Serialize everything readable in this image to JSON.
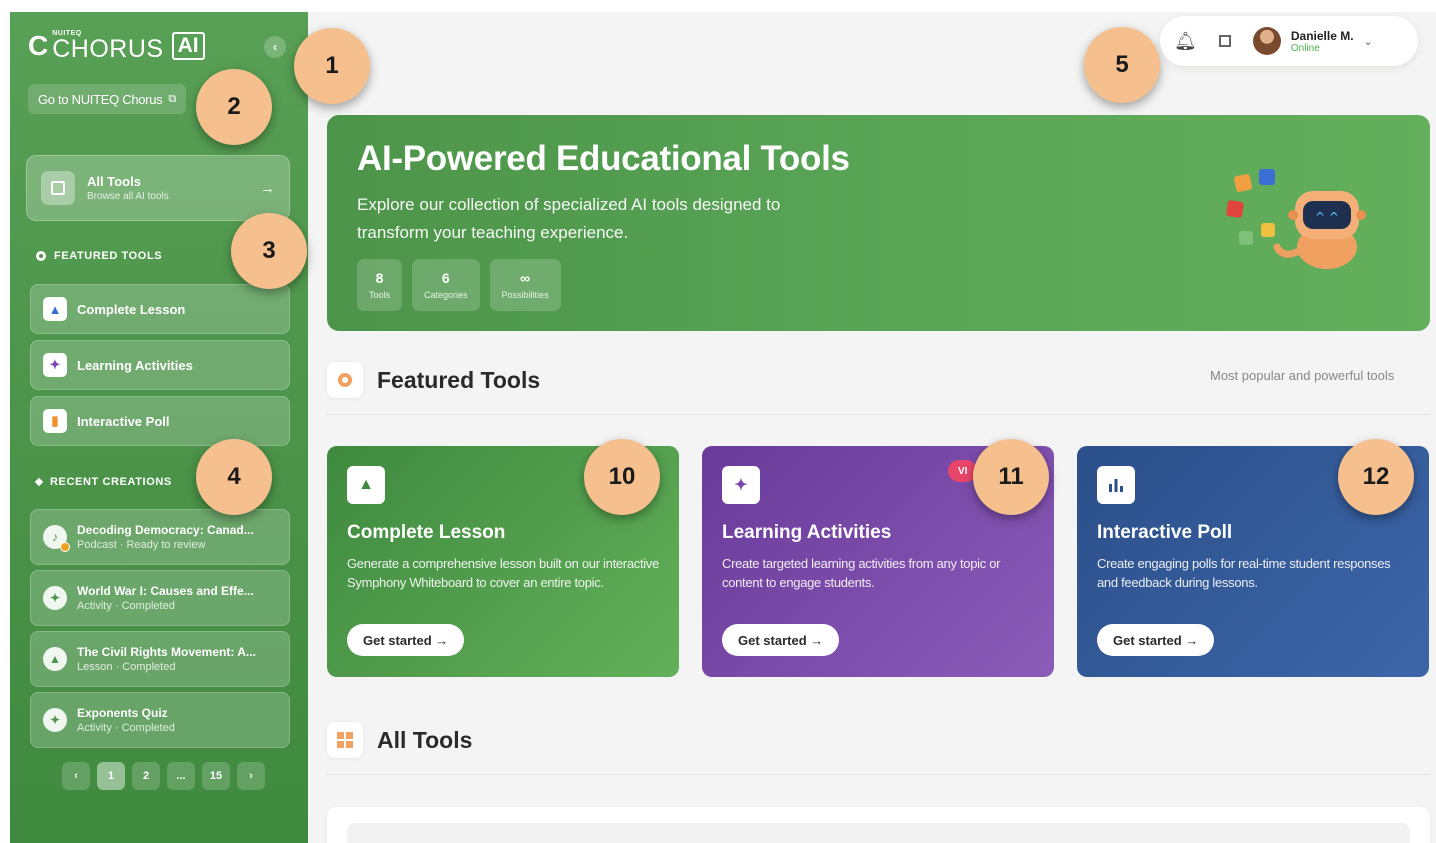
{
  "sidebar": {
    "logo": {
      "c": "C",
      "small": "NUITEQ",
      "big": "CHORUS",
      "ai": "AI"
    },
    "goto_label": "Go to NUITEQ Chorus",
    "all_tools": {
      "title": "All Tools",
      "subtitle": "Browse all AI tools"
    },
    "featured_label": "FEATURED TOOLS",
    "featured": [
      {
        "label": "Complete Lesson",
        "icon": "lesson-icon",
        "color": "#3b6fd6"
      },
      {
        "label": "Learning Activities",
        "icon": "puzzle-icon",
        "color": "#7b45b0"
      },
      {
        "label": "Interactive Poll",
        "icon": "poll-icon",
        "color": "#f0902a"
      }
    ],
    "recent_label": "RECENT CREATIONS",
    "recent": [
      {
        "title": "Decoding Democracy: Canad...",
        "status": "Podcast · Ready to review"
      },
      {
        "title": "World War I: Causes and Effe...",
        "status": "Activity · Completed"
      },
      {
        "title": "The Civil Rights Movement: A...",
        "status": "Lesson · Completed"
      },
      {
        "title": "Exponents Quiz",
        "status": "Activity · Completed"
      }
    ],
    "pager": [
      "‹",
      "1",
      "2",
      "...",
      "15",
      "›"
    ]
  },
  "topbar": {
    "user_name": "Danielle M.",
    "user_status": "Online"
  },
  "hero": {
    "title": "AI-Powered Educational Tools",
    "description": "Explore our collection of specialized AI tools designed to transform your teaching experience.",
    "stats": [
      {
        "value": "8",
        "label": "Tools"
      },
      {
        "value": "6",
        "label": "Categories"
      },
      {
        "value": "∞",
        "label": "Possibilities"
      }
    ]
  },
  "featured_section": {
    "title": "Featured Tools",
    "subtitle": "Most popular and powerful tools"
  },
  "cards": [
    {
      "title": "Complete Lesson",
      "description": "Generate a comprehensive lesson built on our interactive Symphony Whiteboard to cover an entire topic.",
      "button": "Get started →"
    },
    {
      "title": "Learning Activities",
      "description": "Create targeted learning activities from any topic or content to engage students.",
      "button": "Get started →",
      "pill": "VI"
    },
    {
      "title": "Interactive Poll",
      "description": "Create engaging polls for real-time student responses and feedback during lessons.",
      "button": "Get started →"
    }
  ],
  "all_tools_section": {
    "title": "All Tools"
  },
  "markers": [
    "1",
    "2",
    "3",
    "4",
    "5",
    "10",
    "11",
    "12"
  ],
  "colors": {
    "primary_green": "#4c9449",
    "purple": "#7b45b0",
    "blue": "#2b4f8a",
    "marker": "#f5c08e"
  }
}
